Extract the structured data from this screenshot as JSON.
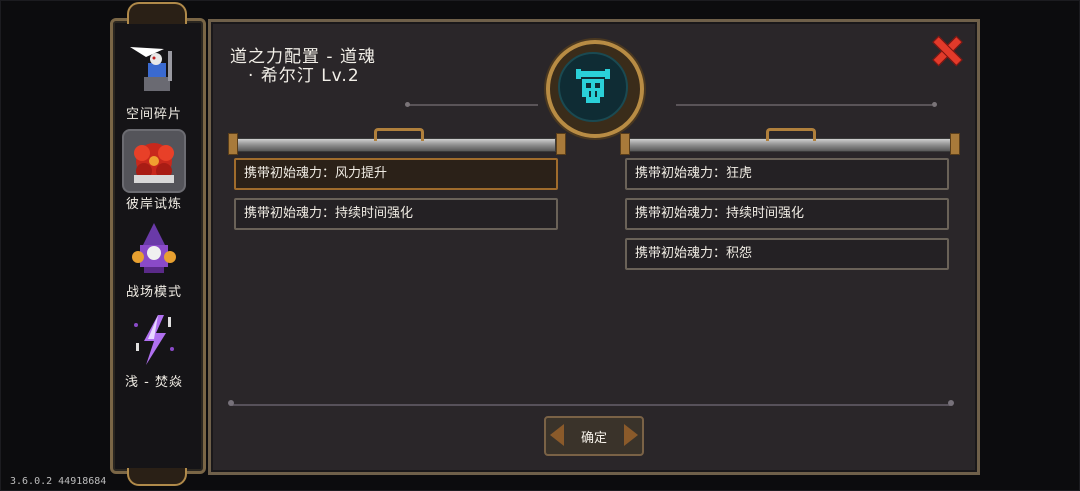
{
  "sidebar": {
    "items": [
      {
        "label": "空间碎片",
        "icon": "space-fragment-icon",
        "active": false
      },
      {
        "label": "彼岸试炼",
        "icon": "trial-flower-icon",
        "active": true
      },
      {
        "label": "战场模式",
        "icon": "battlefield-wizard-icon",
        "active": false
      },
      {
        "label": "浅 - 焚焱",
        "icon": "lightning-icon",
        "active": false
      }
    ]
  },
  "panel": {
    "title_line1": "道之力配置 - 道魂",
    "title_line2": "· 希尔汀 Lv.2",
    "emblem_icon": "viking-skull-icon",
    "close_icon": "close-icon"
  },
  "left_options": [
    {
      "label": "携带初始魂力：风力提升",
      "selected": true
    },
    {
      "label": "携带初始魂力：持续时间强化",
      "selected": false
    }
  ],
  "right_options": [
    {
      "label": "携带初始魂力：狂虎",
      "selected": false
    },
    {
      "label": "携带初始魂力：持续时间强化",
      "selected": false
    },
    {
      "label": "携带初始魂力：积怨",
      "selected": false
    }
  ],
  "confirm_label": "确定",
  "version": "3.6.0.2 44918684",
  "colors": {
    "accent_gold": "#b88c44",
    "close_red": "#e23a2a",
    "selected_border": "#a06c2c",
    "emblem_teal": "#2ad0d8"
  }
}
